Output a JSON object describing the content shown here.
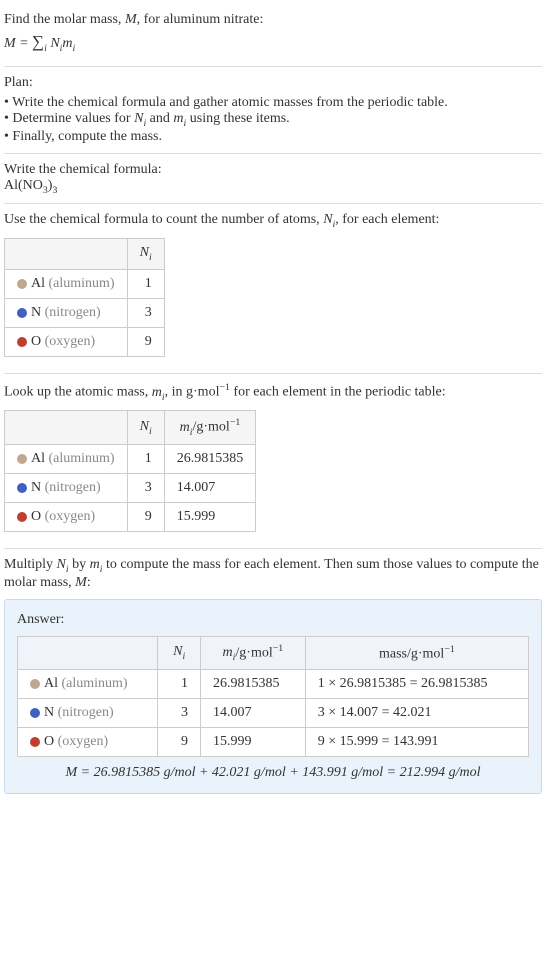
{
  "intro": {
    "line1": "Find the molar mass, M, for aluminum nitrate:",
    "formula_lhs": "M = ",
    "formula_sum": "∑",
    "formula_sub": "i",
    "formula_rhs_a": "N",
    "formula_rhs_b": "m"
  },
  "plan": {
    "title": "Plan:",
    "items": [
      "Write the chemical formula and gather atomic masses from the periodic table.",
      "Determine values for Nᵢ and mᵢ using these items.",
      "Finally, compute the mass."
    ]
  },
  "step_formula": {
    "title": "Write the chemical formula:",
    "formula": "Al(NO",
    "sub1": "3",
    "paren": ")",
    "sub2": "3"
  },
  "step_count": {
    "title": "Use the chemical formula to count the number of atoms, Nᵢ, for each element:",
    "header_ni": "Nᵢ",
    "rows": [
      {
        "sym": "Al",
        "name": "(aluminum)",
        "dot": "dot-al",
        "n": "1"
      },
      {
        "sym": "N",
        "name": "(nitrogen)",
        "dot": "dot-n",
        "n": "3"
      },
      {
        "sym": "O",
        "name": "(oxygen)",
        "dot": "dot-o",
        "n": "9"
      }
    ]
  },
  "step_mass": {
    "title_a": "Look up the atomic mass, mᵢ, in g·mol",
    "title_sup": "−1",
    "title_b": " for each element in the periodic table:",
    "header_ni": "Nᵢ",
    "header_mi": "mᵢ/g·mol⁻¹",
    "rows": [
      {
        "sym": "Al",
        "name": "(aluminum)",
        "dot": "dot-al",
        "n": "1",
        "m": "26.9815385"
      },
      {
        "sym": "N",
        "name": "(nitrogen)",
        "dot": "dot-n",
        "n": "3",
        "m": "14.007"
      },
      {
        "sym": "O",
        "name": "(oxygen)",
        "dot": "dot-o",
        "n": "9",
        "m": "15.999"
      }
    ]
  },
  "step_compute": {
    "title": "Multiply Nᵢ by mᵢ to compute the mass for each element. Then sum those values to compute the molar mass, M:"
  },
  "answer": {
    "label": "Answer:",
    "header_ni": "Nᵢ",
    "header_mi": "mᵢ/g·mol⁻¹",
    "header_mass": "mass/g·mol⁻¹",
    "rows": [
      {
        "sym": "Al",
        "name": "(aluminum)",
        "dot": "dot-al",
        "n": "1",
        "m": "26.9815385",
        "calc": "1 × 26.9815385 = 26.9815385"
      },
      {
        "sym": "N",
        "name": "(nitrogen)",
        "dot": "dot-n",
        "n": "3",
        "m": "14.007",
        "calc": "3 × 14.007 = 42.021"
      },
      {
        "sym": "O",
        "name": "(oxygen)",
        "dot": "dot-o",
        "n": "9",
        "m": "15.999",
        "calc": "9 × 15.999 = 143.991"
      }
    ],
    "final": "M = 26.9815385 g/mol + 42.021 g/mol + 143.991 g/mol = 212.994 g/mol"
  }
}
